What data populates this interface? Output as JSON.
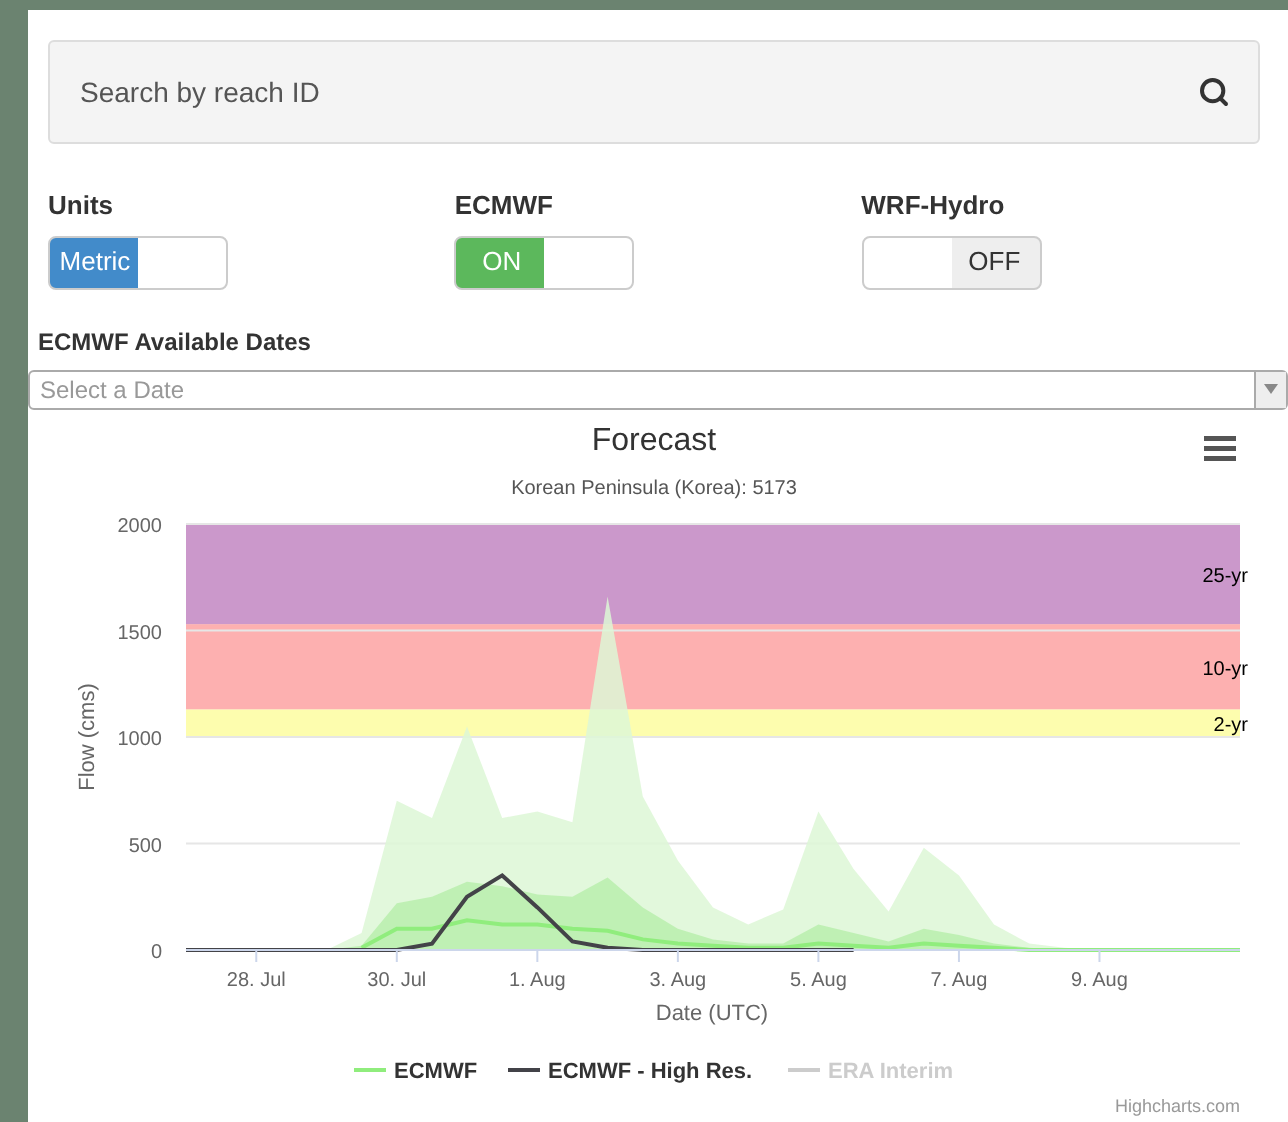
{
  "search": {
    "placeholder": "Search by reach ID"
  },
  "toggles": [
    {
      "label": "Units",
      "state_text": "Metric",
      "on": true,
      "color": "#428bca"
    },
    {
      "label": "ECMWF",
      "state_text": "ON",
      "on": true,
      "color": "#5cb85c"
    },
    {
      "label": "WRF-Hydro",
      "state_text": "OFF",
      "on": false
    }
  ],
  "dates": {
    "label": "ECMWF Available Dates",
    "placeholder": "Select a Date"
  },
  "chart": {
    "chart_data": {
      "type": "area",
      "title": "Forecast",
      "subtitle": "Korean Peninsula (Korea): 5173",
      "xlabel": "Date (UTC)",
      "ylabel": "Flow (cms)",
      "categories": [
        null,
        null,
        "28. Jul",
        null,
        null,
        null,
        "30. Jul",
        null,
        null,
        null,
        "1. Aug",
        null,
        null,
        null,
        "3. Aug",
        null,
        null,
        null,
        "5. Aug",
        null,
        null,
        null,
        "7. Aug",
        null,
        null,
        null,
        "9. Aug",
        null,
        null,
        null,
        null
      ],
      "ylim": [
        0,
        2000
      ],
      "grid": true,
      "legend": "bottom",
      "yticks": [
        0,
        500,
        1000,
        1500,
        2000
      ],
      "series": [
        {
          "type": "area",
          "color": "#ddf7d6",
          "values": [
            0,
            0,
            0,
            0,
            0,
            80,
            700,
            620,
            1050,
            620,
            650,
            600,
            1660,
            720,
            420,
            200,
            120,
            190,
            650,
            380,
            180,
            480,
            350,
            120,
            30,
            10,
            0,
            0,
            0,
            0,
            0
          ]
        },
        {
          "type": "area",
          "color": "#b9efad",
          "values": [
            0,
            0,
            0,
            0,
            0,
            20,
            220,
            250,
            320,
            300,
            260,
            250,
            340,
            200,
            100,
            50,
            30,
            30,
            120,
            80,
            40,
            100,
            70,
            30,
            10,
            0,
            0,
            0,
            0,
            0,
            0
          ]
        },
        {
          "type": "line",
          "name": "ECMWF",
          "color": "#90ed7d",
          "values": [
            null,
            null,
            null,
            null,
            null,
            10,
            100,
            100,
            140,
            120,
            120,
            100,
            90,
            50,
            30,
            20,
            10,
            10,
            30,
            20,
            10,
            30,
            20,
            10,
            0,
            0,
            0,
            0,
            0,
            0,
            0
          ]
        },
        {
          "type": "line",
          "name": "ECMWF - High Res.",
          "color": "#434348",
          "values": [
            0,
            0,
            0,
            0,
            0,
            0,
            0,
            30,
            250,
            350,
            200,
            40,
            10,
            0,
            0,
            0,
            0,
            0,
            0,
            0,
            null,
            null,
            null,
            null,
            null,
            null,
            null,
            null,
            null,
            null,
            null
          ]
        }
      ],
      "bands": [
        {
          "axis": "y",
          "from": 1000,
          "to": 1130,
          "label": "2-yr",
          "color": "#fdfdae"
        },
        {
          "axis": "y",
          "from": 1130,
          "to": 1530,
          "label": "10-yr",
          "color": "#fdb0b0"
        },
        {
          "axis": "y",
          "from": 1530,
          "to": 2000,
          "label": "25-yr",
          "color": "#cb98cb"
        }
      ]
    },
    "extra_legend": [
      {
        "label": "ERA Interim",
        "visible": false
      }
    ],
    "credit": "Highcharts.com"
  }
}
